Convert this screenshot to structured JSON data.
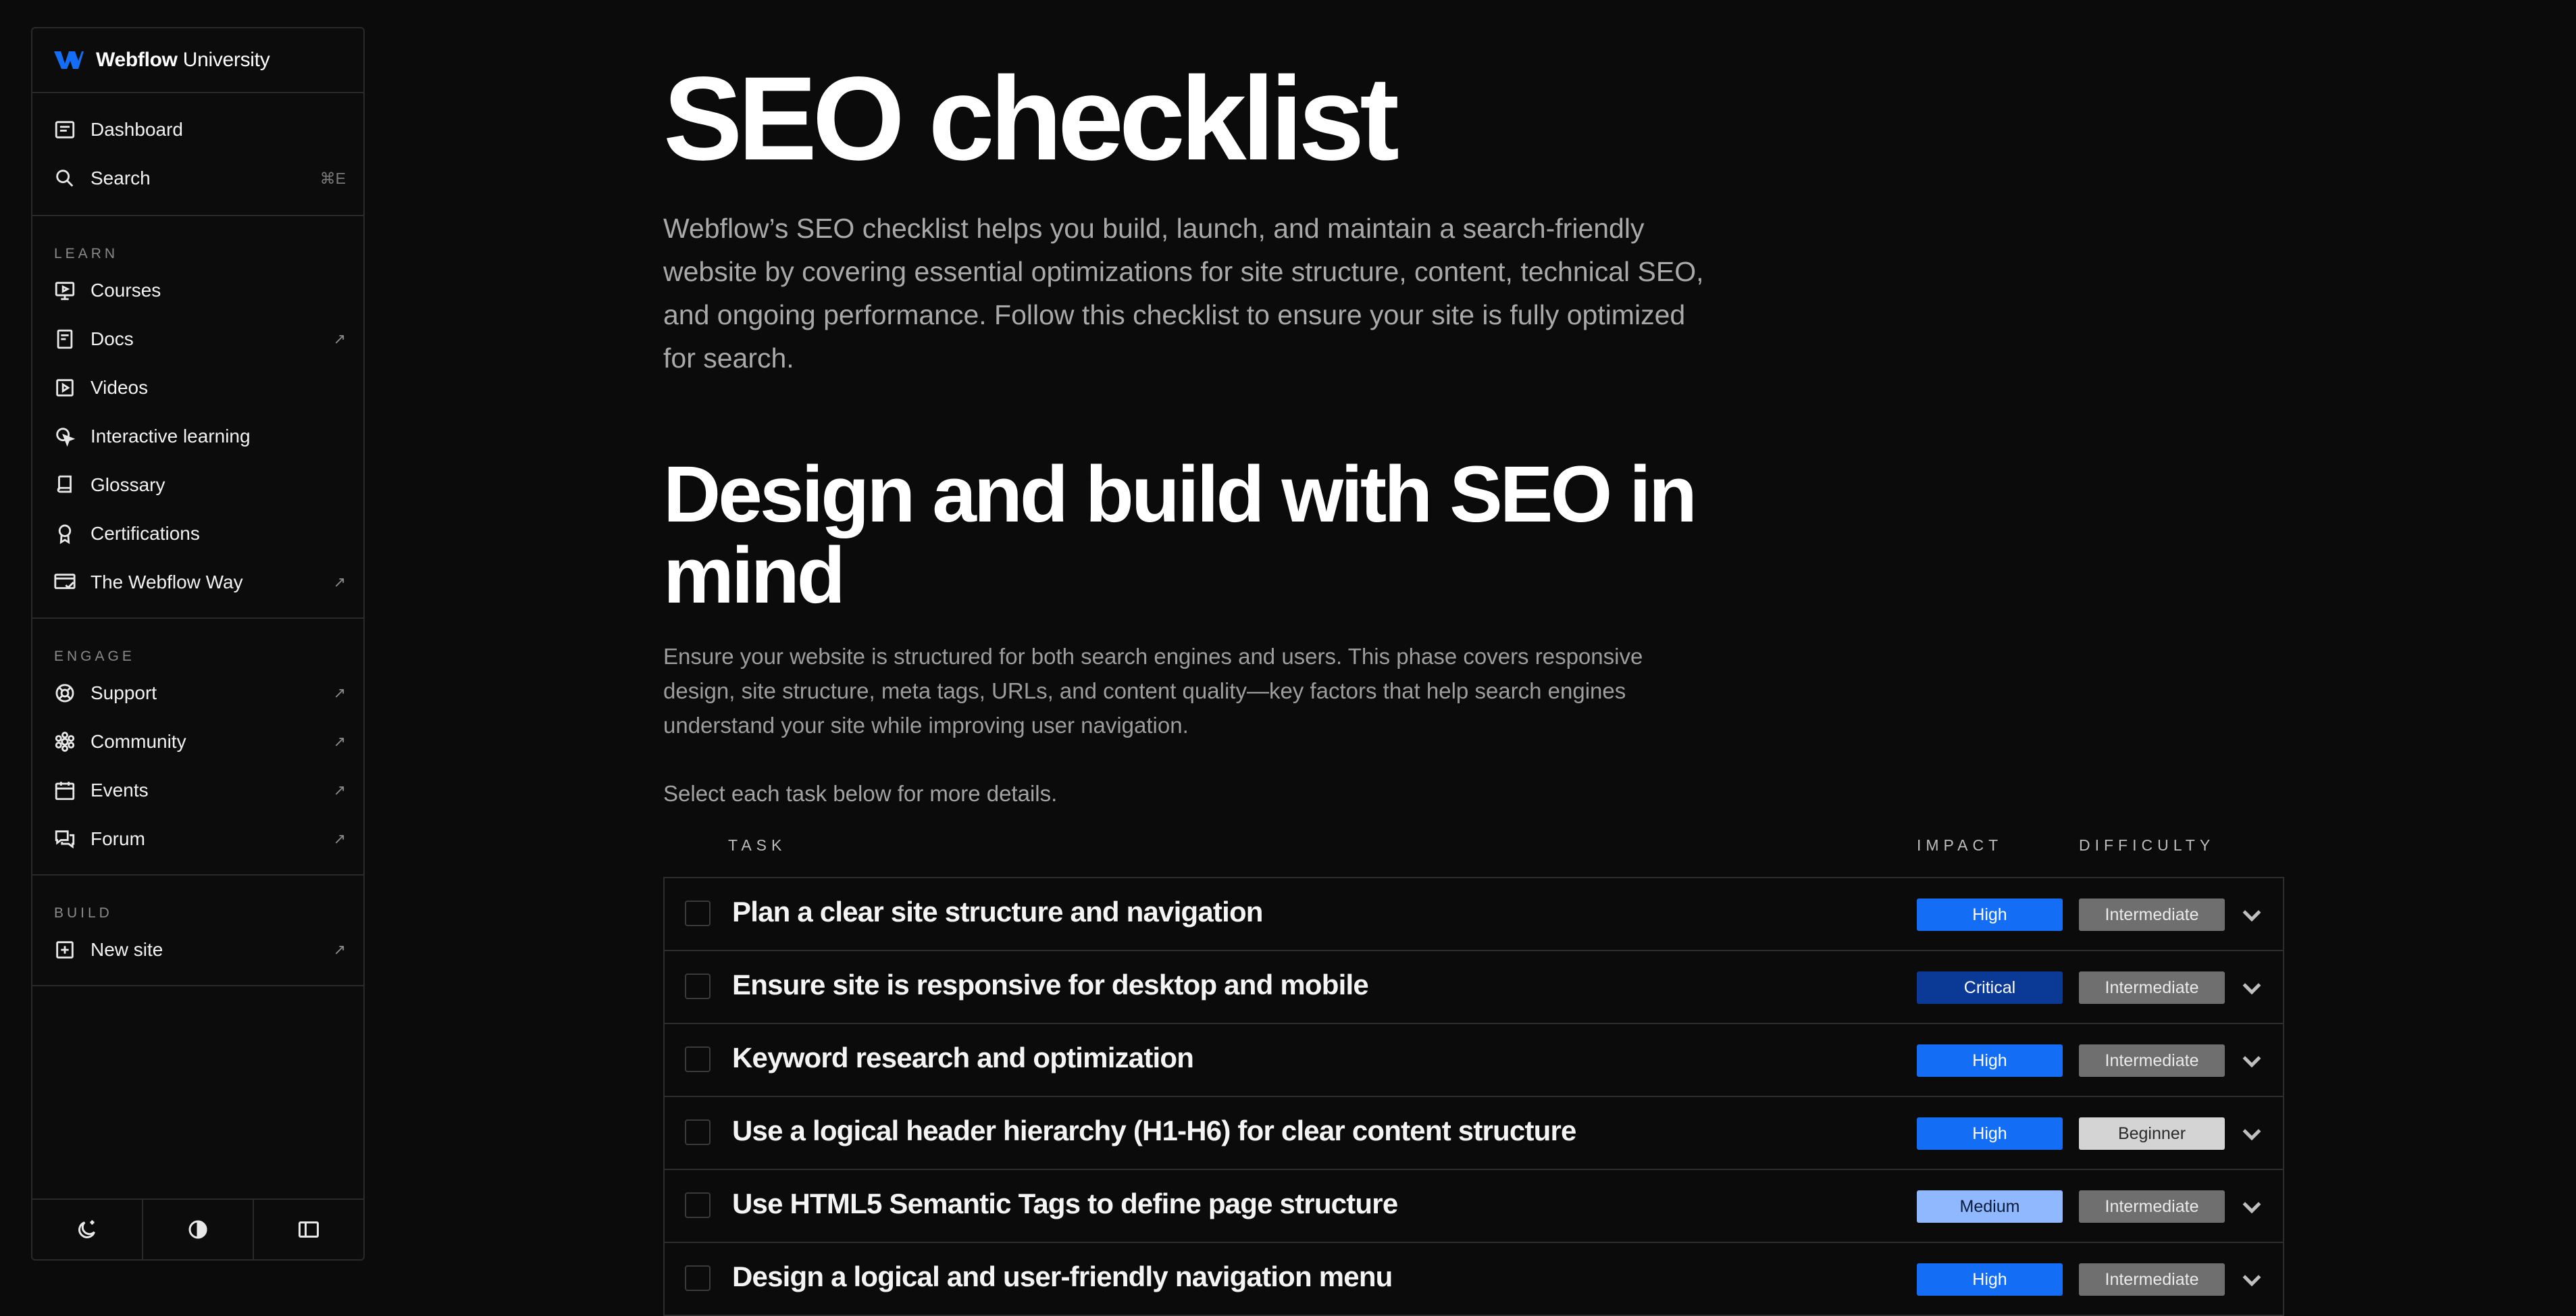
{
  "sidebar": {
    "brand_bold": "Webflow",
    "brand_rest": " University",
    "top_items": [
      {
        "label": "Dashboard",
        "icon": "dashboard-icon"
      },
      {
        "label": "Search",
        "icon": "search-icon",
        "shortcut": "⌘E"
      }
    ],
    "learn_label": "LEARN",
    "learn_items": [
      {
        "label": "Courses",
        "icon": "courses-icon",
        "external": false
      },
      {
        "label": "Docs",
        "icon": "docs-icon",
        "external": true
      },
      {
        "label": "Videos",
        "icon": "videos-icon",
        "external": false
      },
      {
        "label": "Interactive learning",
        "icon": "interactive-icon",
        "external": false
      },
      {
        "label": "Glossary",
        "icon": "glossary-icon",
        "external": false
      },
      {
        "label": "Certifications",
        "icon": "certifications-icon",
        "external": false
      },
      {
        "label": "The Webflow Way",
        "icon": "webflow-way-icon",
        "external": true
      }
    ],
    "engage_label": "ENGAGE",
    "engage_items": [
      {
        "label": "Support",
        "icon": "support-icon",
        "external": true
      },
      {
        "label": "Community",
        "icon": "community-icon",
        "external": true
      },
      {
        "label": "Events",
        "icon": "events-icon",
        "external": true
      },
      {
        "label": "Forum",
        "icon": "forum-icon",
        "external": true
      }
    ],
    "build_label": "BUILD",
    "build_items": [
      {
        "label": "New site",
        "icon": "new-site-icon",
        "external": true
      }
    ],
    "external_glyph": "↗"
  },
  "page": {
    "title": "SEO checklist",
    "intro": "Webflow’s SEO checklist helps you build, launch, and maintain a search-friendly website by covering essential optimizations for site structure, content, technical SEO, and ongoing performance. Follow this checklist to ensure your site is fully optimized for search.",
    "phase_title": "Design and build with SEO in mind",
    "phase_desc": "Ensure your website is structured for both search engines and users. This phase covers responsive design, site structure, meta tags, URLs, and content quality—key factors that help search engines understand your site while improving user navigation.",
    "select_note": "Select each task below for more details."
  },
  "table": {
    "headers": {
      "task": "TASK",
      "impact": "IMPACT",
      "difficulty": "DIFFICULTY"
    },
    "rows": [
      {
        "title": "Plan a clear site structure and navigation",
        "impact": "High",
        "difficulty": "Intermediate"
      },
      {
        "title": "Ensure site is responsive for desktop and mobile",
        "impact": "Critical",
        "difficulty": "Intermediate"
      },
      {
        "title": "Keyword research and optimization",
        "impact": "High",
        "difficulty": "Intermediate"
      },
      {
        "title": "Use a logical header hierarchy (H1-H6) for clear content structure",
        "impact": "High",
        "difficulty": "Beginner"
      },
      {
        "title": "Use HTML5 Semantic Tags to define page structure",
        "impact": "Medium",
        "difficulty": "Intermediate"
      },
      {
        "title": "Design a logical and user-friendly navigation menu",
        "impact": "High",
        "difficulty": "Intermediate"
      }
    ]
  },
  "colors": {
    "impact": {
      "High": {
        "bg": "#146ef5",
        "fg": "#ffffff"
      },
      "Critical": {
        "bg": "#0a3a96",
        "fg": "#ffffff"
      },
      "Medium": {
        "bg": "#8fb8ff",
        "fg": "#0b1c3c"
      }
    },
    "difficulty": {
      "Intermediate": {
        "bg": "#6f6f6f",
        "fg": "#eaeaea"
      },
      "Beginner": {
        "bg": "#d4d4d4",
        "fg": "#2a2a2a"
      }
    }
  }
}
